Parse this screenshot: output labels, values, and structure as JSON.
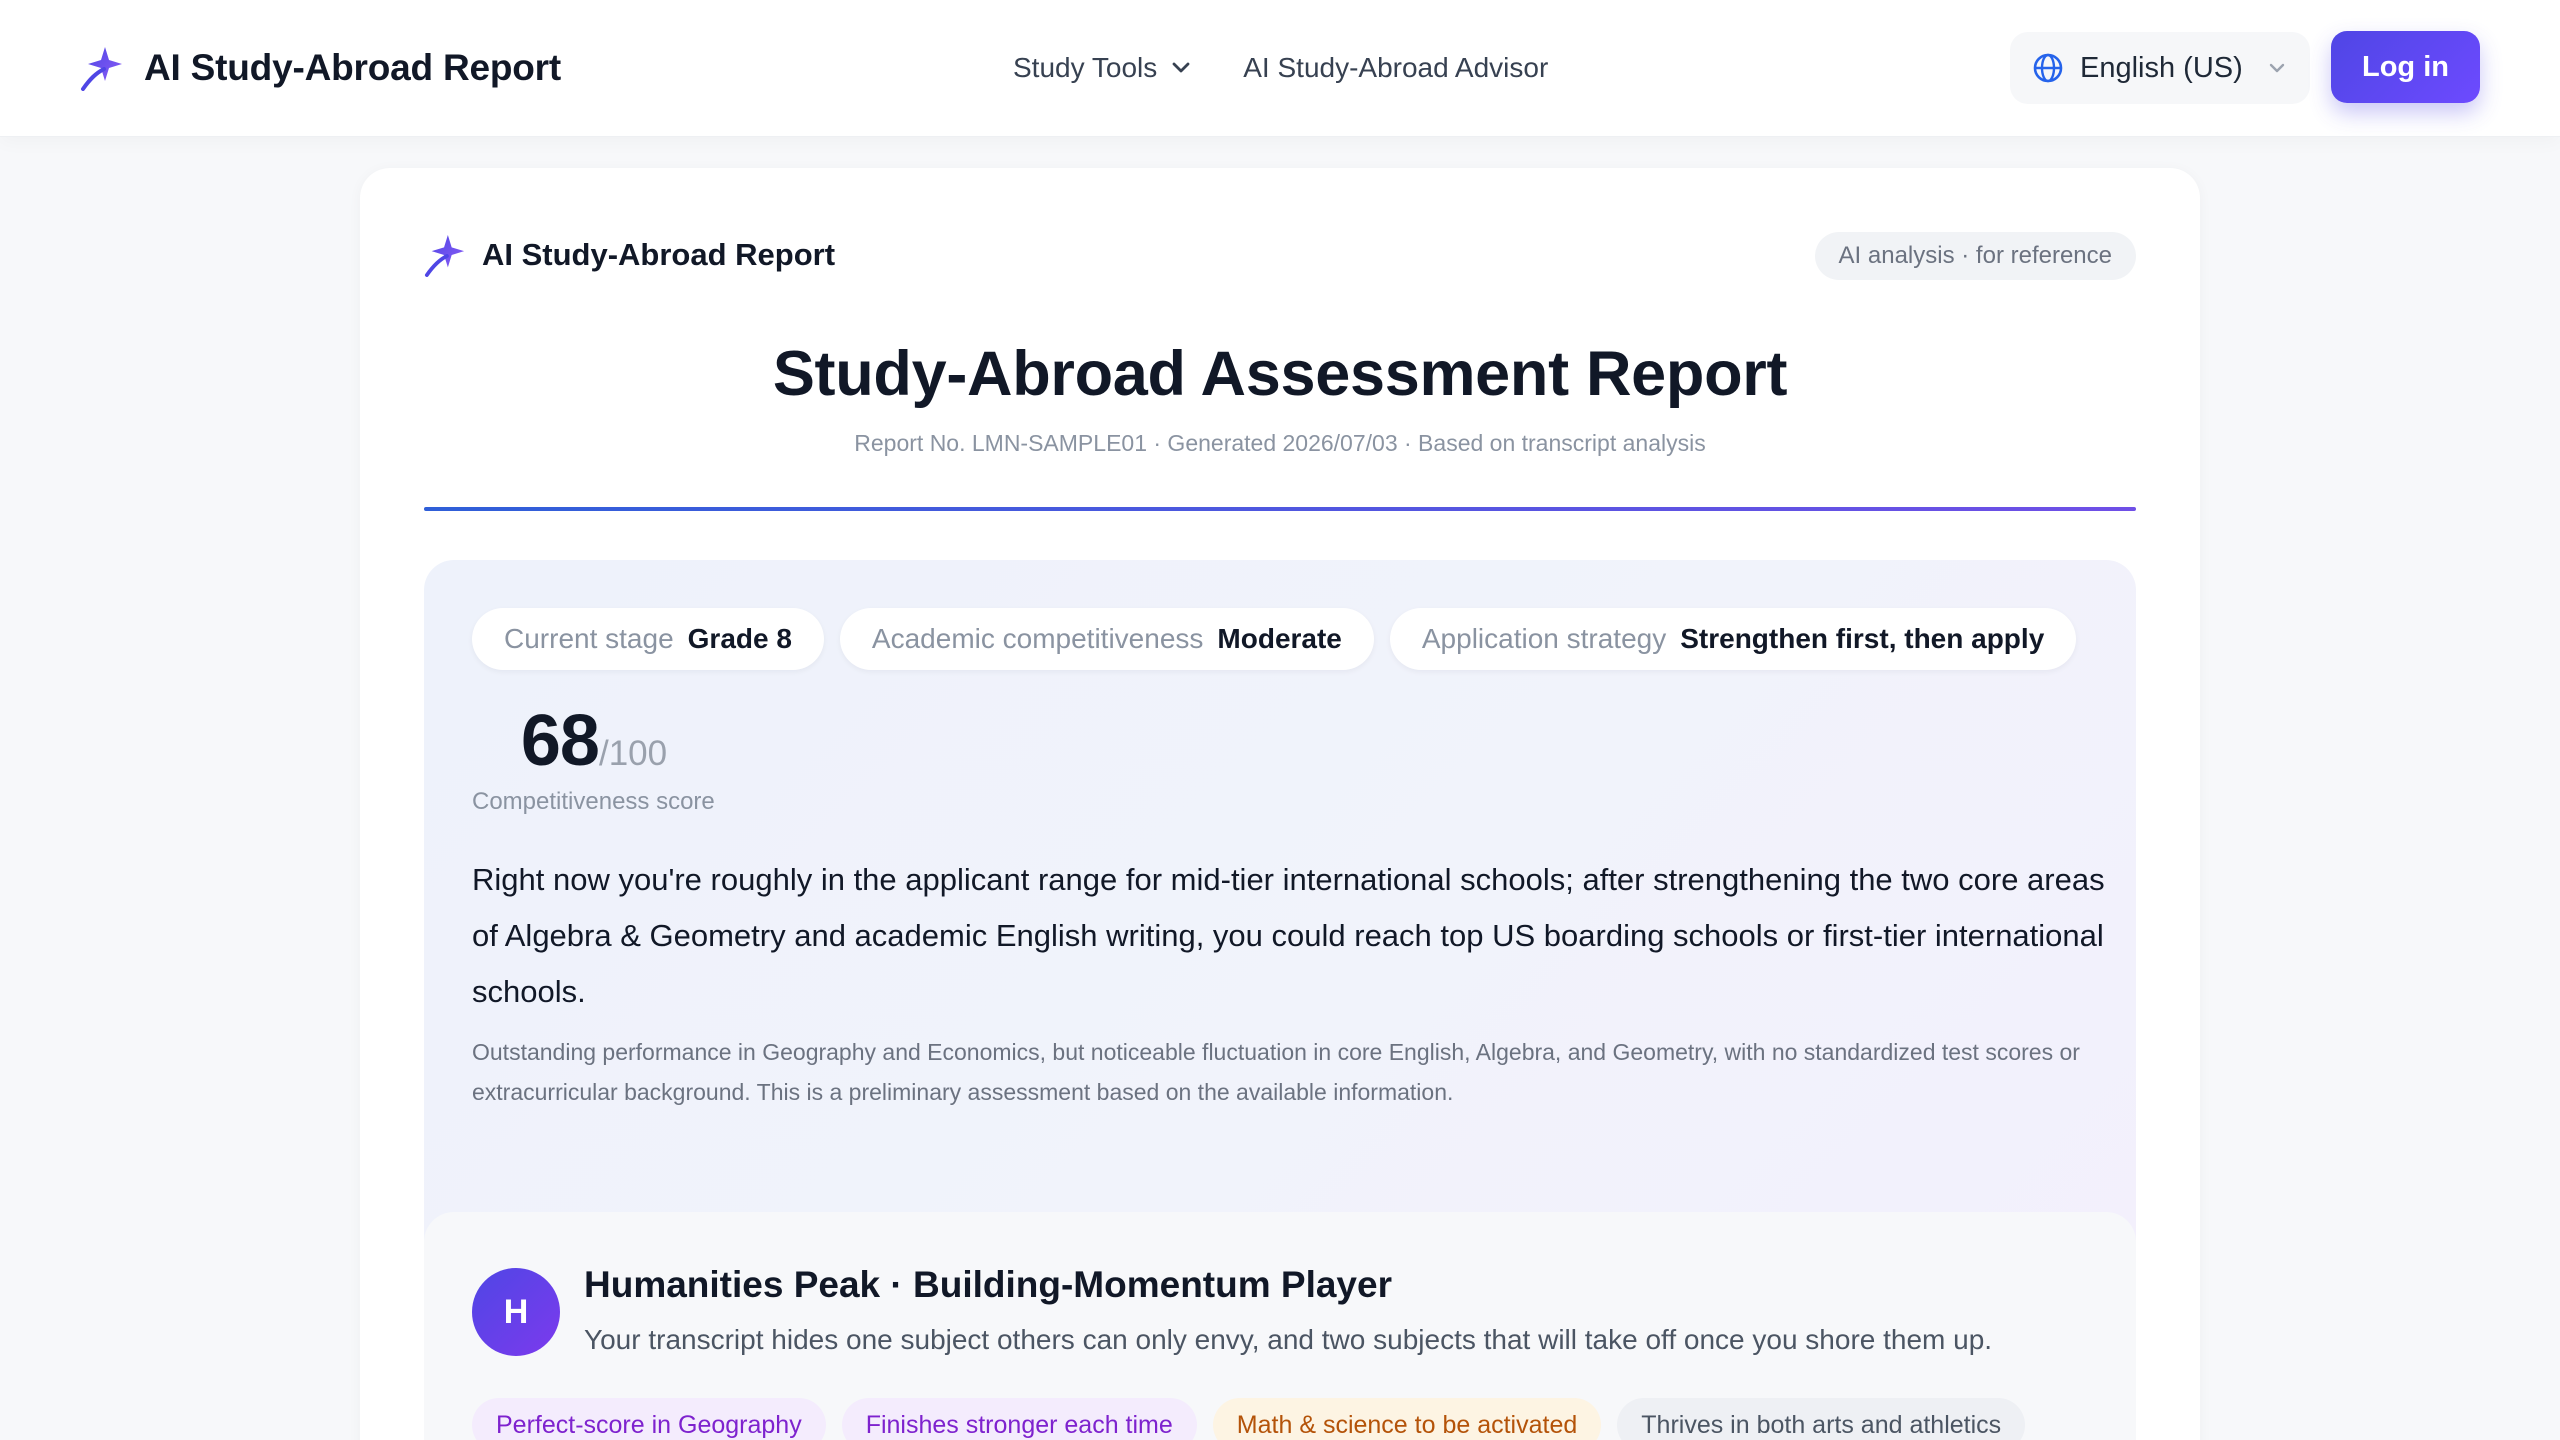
{
  "nav": {
    "brand_title": "AI Study-Abroad Report",
    "links": [
      {
        "label": "Study Tools"
      },
      {
        "label": "AI Study-Abroad Advisor"
      }
    ],
    "language": "English (US)",
    "login_label": "Log in"
  },
  "report": {
    "brand_title": "AI Study-Abroad Report",
    "reference_pill": "AI analysis · for reference",
    "title": "Study-Abroad Assessment Report",
    "meta": "Report No. LMN-SAMPLE01 · Generated 2026/07/03 · Based on transcript analysis",
    "summary": {
      "chips": [
        {
          "label": "Current stage",
          "value": "Grade 8"
        },
        {
          "label": "Academic competitiveness",
          "value": "Moderate"
        },
        {
          "label": "Application strategy",
          "value": "Strengthen first, then apply"
        }
      ],
      "score": {
        "value": "68",
        "max": "/100",
        "label": "Competitiveness score"
      },
      "main_text": "Right now you're roughly in the applicant range for mid-tier international schools; after strengthening the two core areas of Algebra & Geometry and academic English writing, you could reach top US boarding schools or first-tier international schools.",
      "sub_text": "Outstanding performance in Geography and Economics, but noticeable fluctuation in core English, Algebra, and Geometry, with no standardized test scores or extracurricular background. This is a preliminary assessment based on the available information."
    },
    "profile": {
      "avatar_letter": "H",
      "title": "Humanities Peak · Building-Momentum Player",
      "description": "Your transcript hides one subject others can only envy, and two subjects that will take off once you shore them up.",
      "tags": [
        {
          "label": "Perfect-score in Geography",
          "color": "#7e22ce"
        },
        {
          "label": "Finishes stronger each time",
          "color": "#7e22ce"
        },
        {
          "label": "Math & science to be activated",
          "color": "#b45309"
        },
        {
          "label": "Thrives in both arts and athletics",
          "color": "#4b5563"
        }
      ]
    }
  },
  "colors": {
    "accent": "#4f46e5",
    "accent_purple": "#7c3aed",
    "divider_start": "#2f5fd8",
    "divider_end": "#6f4fe6"
  }
}
